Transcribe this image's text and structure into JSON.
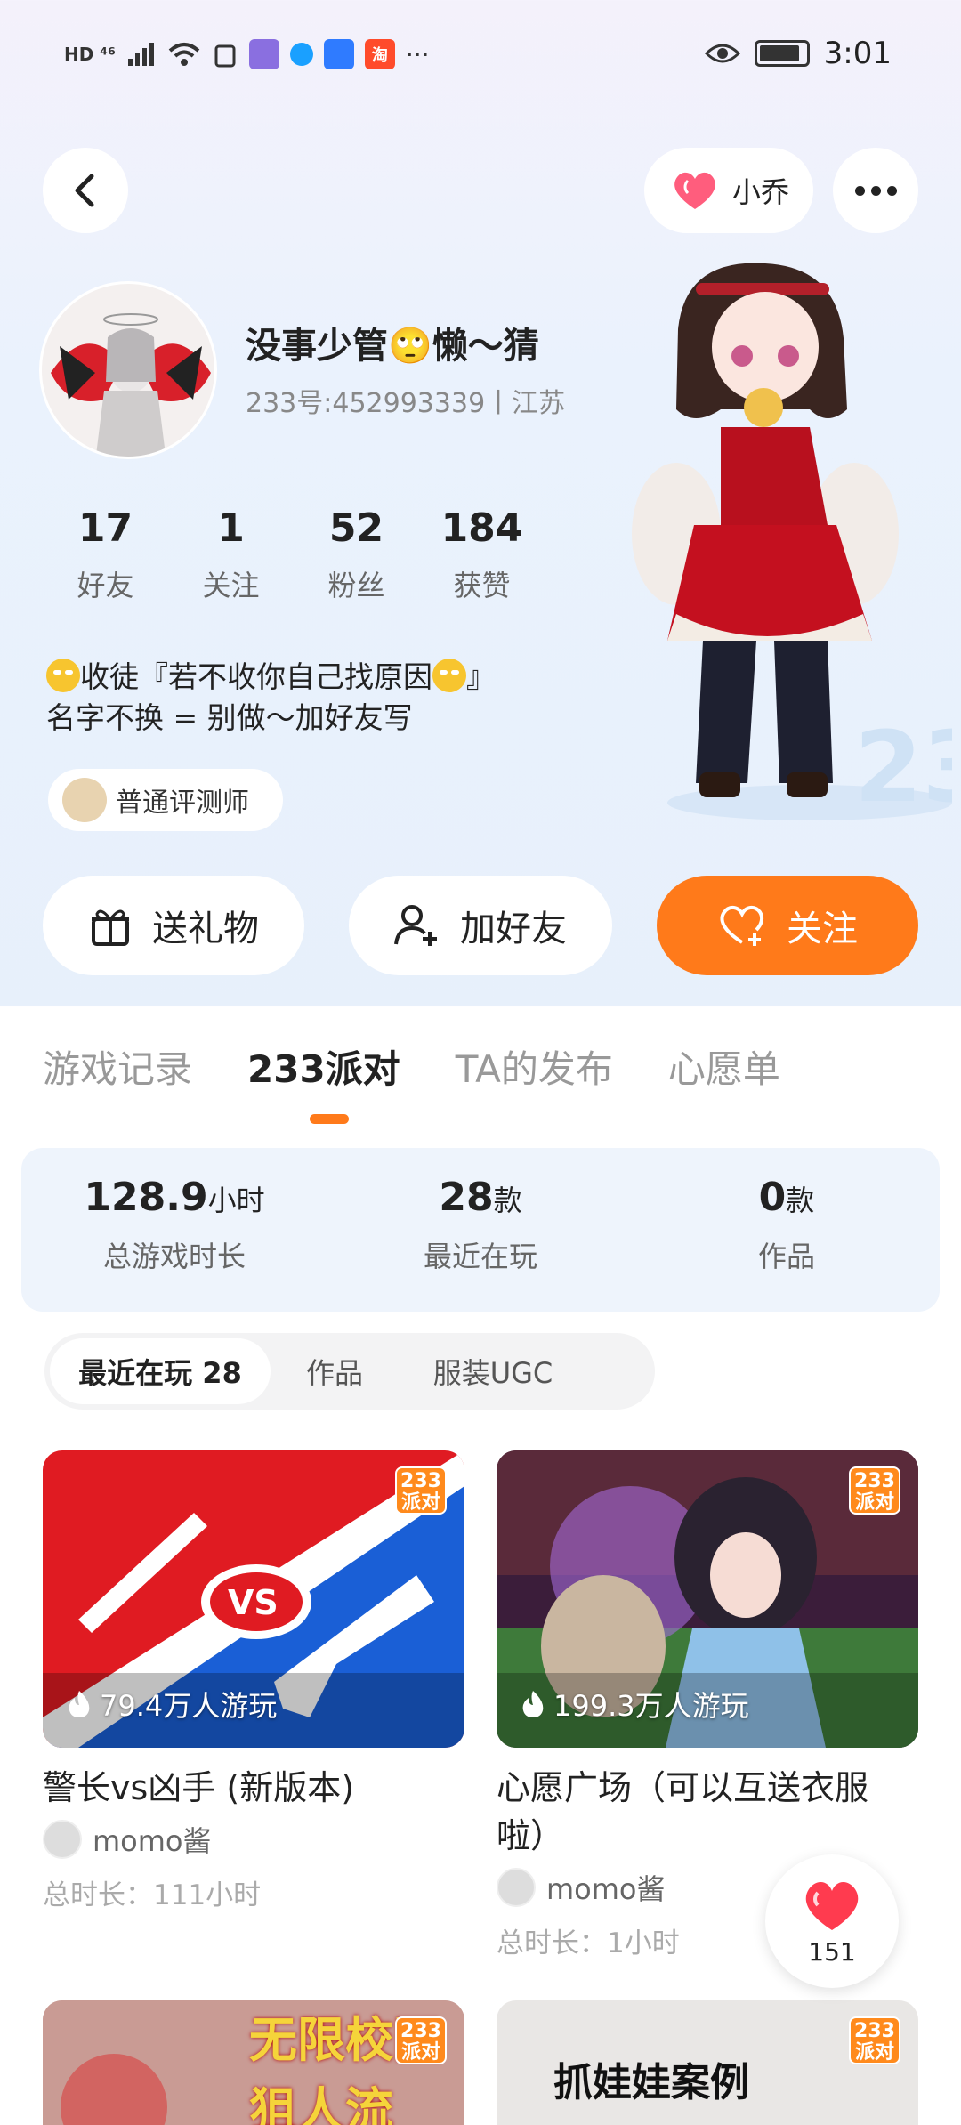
{
  "status_bar": {
    "left_text": "HD ⁴⁶",
    "time": "3:01"
  },
  "header": {
    "pet_name": "小乔"
  },
  "profile": {
    "username": "没事少管🙄懒～猜",
    "id_line": "233号:452993339丨江苏",
    "stats": [
      {
        "num": "17",
        "label": "好友"
      },
      {
        "num": "1",
        "label": "关注"
      },
      {
        "num": "52",
        "label": "粉丝"
      },
      {
        "num": "184",
        "label": "获赞"
      }
    ],
    "bio_line1_a": "收徒『若不收你自己找原因",
    "bio_line1_b": "』",
    "bio_line2": "名字不换 = 别做～加好友写",
    "badge": "普通评测师"
  },
  "actions": {
    "gift": "送礼物",
    "add_friend": "加好友",
    "follow": "关注"
  },
  "tabs": [
    "游戏记录",
    "233派对",
    "TA的发布",
    "心愿单"
  ],
  "summary": [
    {
      "num": "128.9",
      "unit": "小时",
      "label": "总游戏时长"
    },
    {
      "num": "28",
      "unit": "款",
      "label": "最近在玩"
    },
    {
      "num": "0",
      "unit": "款",
      "label": "作品"
    }
  ],
  "subtabs": [
    "最近在玩 28",
    "作品",
    "服装UGC"
  ],
  "games": [
    {
      "plays": "79.4万人游玩",
      "title": "警长vs凶手 (新版本)",
      "author": "momo酱",
      "time": "总时长：111小时",
      "tag": "233派对"
    },
    {
      "plays": "199.3万人游玩",
      "title": "心愿广场（可以互送衣服啦）",
      "author": "momo酱",
      "time": "总时长：1小时",
      "tag": "233派对"
    }
  ],
  "partial_games": [
    {
      "text": "无限校园 狙人流"
    },
    {
      "text": "抓娃娃案例"
    }
  ],
  "like_count": "151",
  "colors": {
    "accent": "#ff7a1a",
    "summary_bg": "#eef4fc"
  }
}
